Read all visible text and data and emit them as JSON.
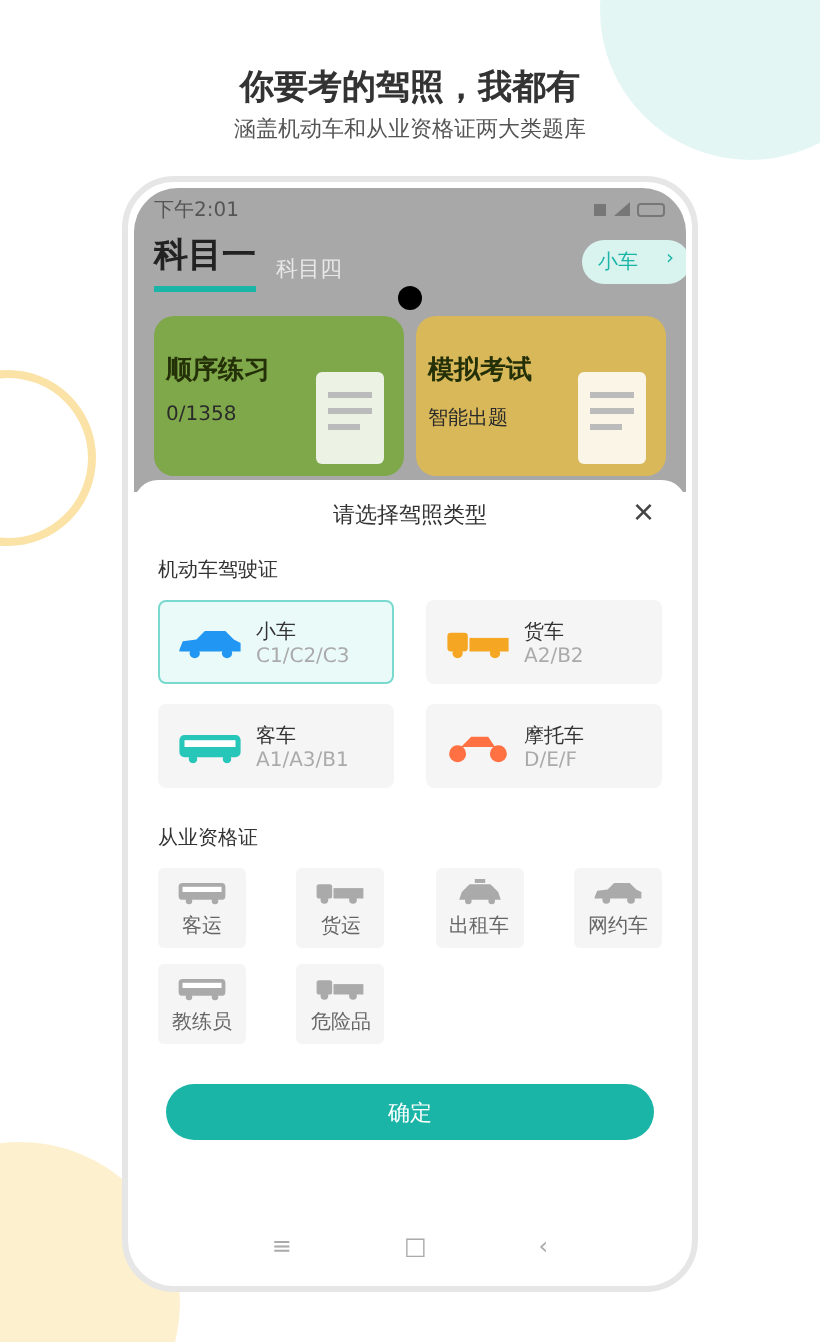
{
  "headline": "你要考的驾照，我都有",
  "subtitle": "涵盖机动车和从业资格证两大类题库",
  "status_bar": {
    "time": "下午2:01"
  },
  "tabs": [
    {
      "label": "科目一",
      "selected": true
    },
    {
      "label": "科目四",
      "selected": false
    }
  ],
  "vehicle_pill": {
    "label": "小车",
    "chevron": "›"
  },
  "cards": [
    {
      "title": "顺序练习",
      "subtitle": "0/1358"
    },
    {
      "title": "模拟考试",
      "subtitle": "智能出题"
    }
  ],
  "sheet": {
    "title": "请选择驾照类型",
    "close": "×",
    "sections": [
      {
        "heading": "机动车驾驶证",
        "items": [
          {
            "kind": "car",
            "name": "小车",
            "classes": "C1/C2/C3",
            "selected": true
          },
          {
            "kind": "truck",
            "name": "货车",
            "classes": "A2/B2",
            "selected": false
          },
          {
            "kind": "bus",
            "name": "客车",
            "classes": "A1/A3/B1",
            "selected": false
          },
          {
            "kind": "motorcycle",
            "name": "摩托车",
            "classes": "D/E/F",
            "selected": false
          }
        ]
      },
      {
        "heading": "从业资格证",
        "items": [
          {
            "kind": "bus",
            "name": "客运"
          },
          {
            "kind": "truck",
            "name": "货运"
          },
          {
            "kind": "taxi",
            "name": "出租车"
          },
          {
            "kind": "car",
            "name": "网约车"
          },
          {
            "kind": "bus",
            "name": "教练员"
          },
          {
            "kind": "truck",
            "name": "危险品"
          }
        ]
      }
    ],
    "confirm": "确定"
  },
  "nav_bar": [
    "≡",
    "□",
    "‹"
  ]
}
